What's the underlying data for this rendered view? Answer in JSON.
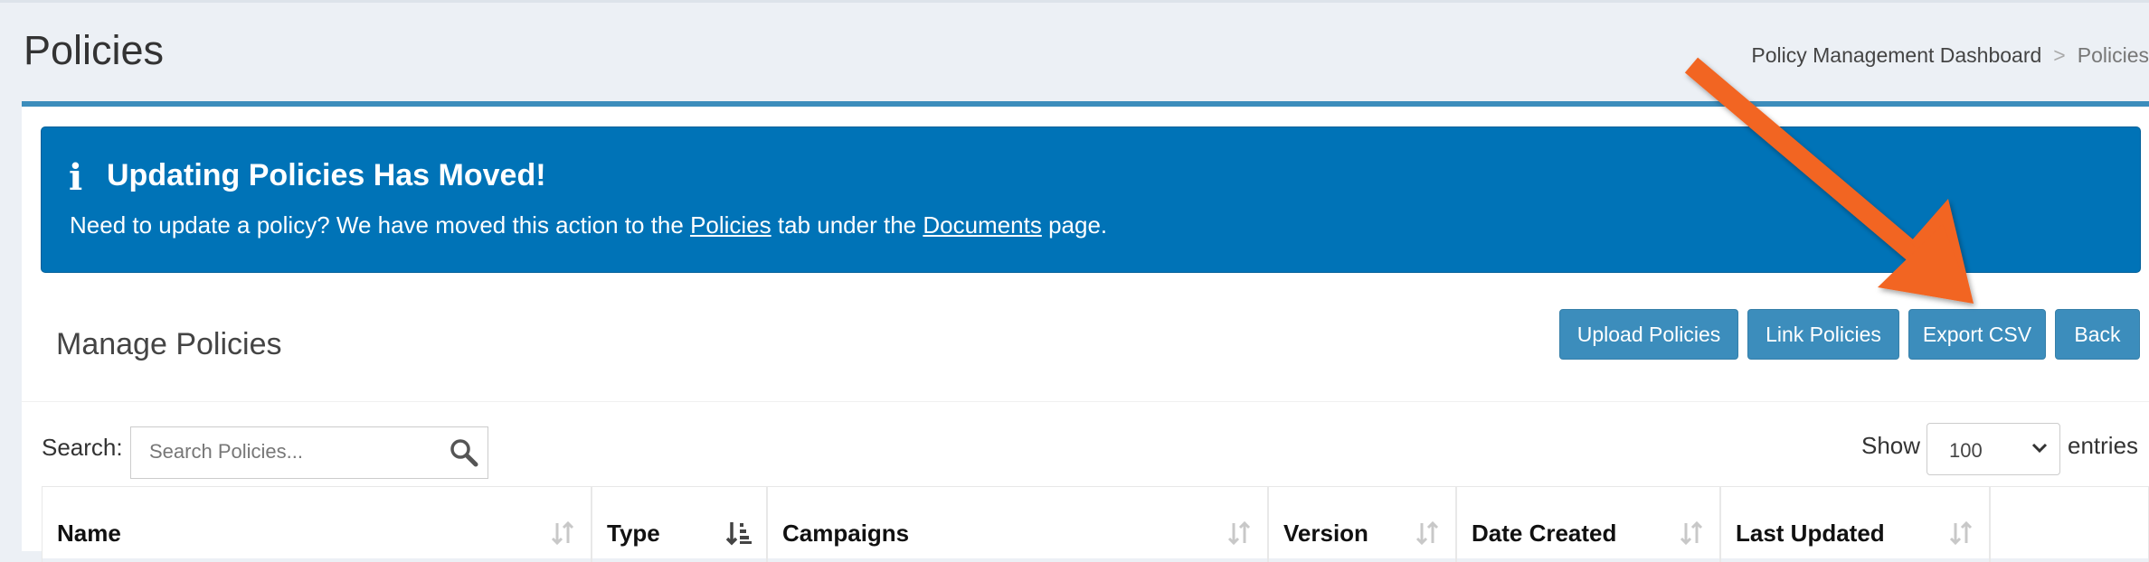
{
  "header": {
    "page_title": "Policies",
    "breadcrumb": {
      "parent": "Policy Management Dashboard",
      "separator": ">",
      "current": "Policies"
    }
  },
  "callout": {
    "icon": "info-icon",
    "title": "Updating Policies Has Moved!",
    "text_before": "Need to update a policy? We have moved this action to the ",
    "link1": "Policies",
    "text_middle": " tab under the ",
    "link2": "Documents",
    "text_after": " page.",
    "color": "#0073b7"
  },
  "box": {
    "title": "Manage Policies",
    "buttons": {
      "upload": "Upload Policies",
      "link": "Link Policies",
      "export": "Export CSV",
      "back": "Back"
    },
    "button_color": "#3c8dbc"
  },
  "table_controls": {
    "search_label": "Search:",
    "search_placeholder": "Search Policies...",
    "show_label": "Show",
    "entries_selected": "100",
    "entries_label": "entries"
  },
  "table": {
    "columns": [
      {
        "label": "Name",
        "sort": "unsorted"
      },
      {
        "label": "Type",
        "sort": "ascending"
      },
      {
        "label": "Campaigns",
        "sort": "unsorted"
      },
      {
        "label": "Version",
        "sort": "unsorted"
      },
      {
        "label": "Date Created",
        "sort": "unsorted"
      },
      {
        "label": "Last Updated",
        "sort": "unsorted"
      }
    ]
  },
  "annotation": {
    "type": "arrow",
    "color": "#f26522",
    "points_to": "Export CSV"
  }
}
